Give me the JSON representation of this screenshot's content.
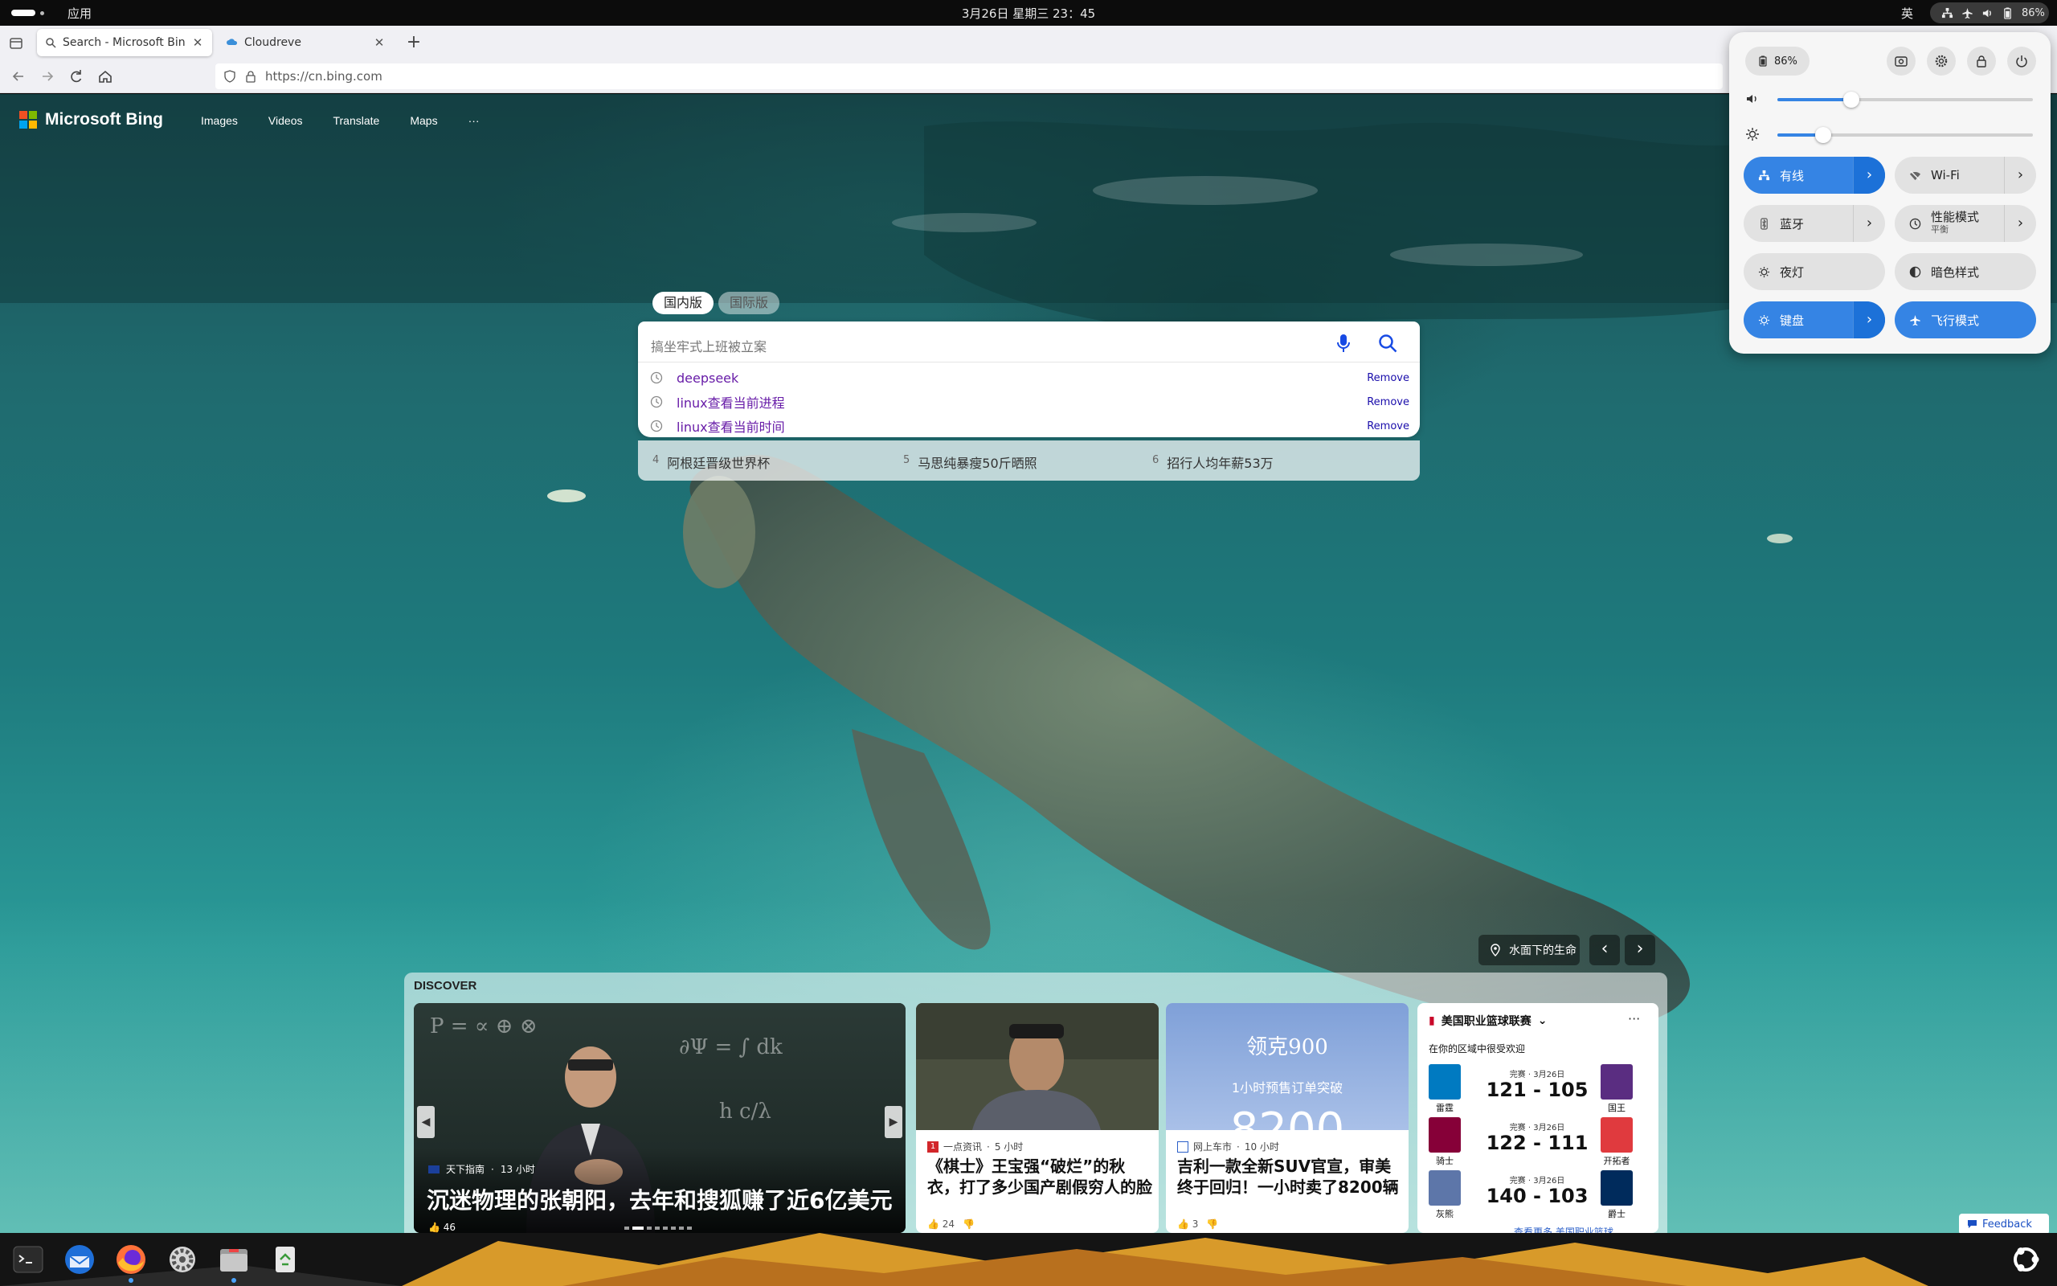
{
  "system_bar": {
    "apps_label": "应用",
    "clock": "3月26日 星期三 23：45",
    "input_method": "英",
    "battery_percent": "86%"
  },
  "browser": {
    "tabs": [
      {
        "title": "Search - Microsoft Bing",
        "active": true
      },
      {
        "title": "Cloudreve",
        "active": false
      }
    ],
    "url": "https://cn.bing.com"
  },
  "bing": {
    "logo_text": "Microsoft Bing",
    "nav": [
      "Images",
      "Videos",
      "Translate",
      "Maps",
      "···"
    ],
    "scope_active": "国内版",
    "scope_inactive": "国际版",
    "search_placeholder": "搞坐牢式上班被立案",
    "history": [
      {
        "text": "deepseek",
        "action": "Remove"
      },
      {
        "text": "linux查看当前进程",
        "action": "Remove"
      },
      {
        "text": "linux查看当前时间",
        "action": "Remove"
      }
    ],
    "trending": [
      {
        "rank": "4",
        "text": "阿根廷晋级世界杯"
      },
      {
        "rank": "5",
        "text": "马思纯暴瘦50斤晒照"
      },
      {
        "rank": "6",
        "text": "招行人均年薪53万"
      }
    ],
    "image_title": "水面下的生命",
    "image_prev": "‹",
    "image_next": "›",
    "feedback": "Feedback"
  },
  "discover": {
    "header": "DISCOVER",
    "cards": [
      {
        "source": "天下指南",
        "time": "13 小时",
        "title": "沉迷物理的张朝阳，去年和搜狐赚了近6亿美元",
        "likes": "46"
      },
      {
        "source": "一点资讯",
        "time": "5 小时",
        "title": "《棋士》王宝强“破烂”的秋衣，打了多少国产剧假穷人的脸",
        "likes": "24"
      },
      {
        "source": "网上车市",
        "time": "10 小时",
        "title": "吉利一款全新SUV官宣，审美终于回归！一小时卖了8200辆",
        "likes": "3",
        "photo_text_1": "领克900",
        "photo_text_2": "1小时预售订单突破",
        "photo_text_3": "8200"
      }
    ],
    "nba": {
      "title": "美国职业篮球联赛",
      "more": "···",
      "subtitle": "在你的区域中很受欢迎",
      "see_more": "查看更多 美国职业篮球",
      "games": [
        {
          "label": "完赛 · 3月26日",
          "score": "121 - 105",
          "home": "雷霆",
          "away": "国王",
          "home_color": "#007ac1",
          "away_color": "#5a2d81"
        },
        {
          "label": "完赛 · 3月26日",
          "score": "122 - 111",
          "home": "骑士",
          "away": "开拓者",
          "home_color": "#860038",
          "away_color": "#e03a3e"
        },
        {
          "label": "完赛 · 3月26日",
          "score": "140 - 103",
          "home": "灰熊",
          "away": "爵士",
          "home_color": "#5d76a9",
          "away_color": "#002b5c"
        }
      ]
    }
  },
  "quick_settings": {
    "battery": "86%",
    "volume_level": 0.29,
    "brightness_level": 0.18,
    "toggles": [
      {
        "label": "有线",
        "on": true,
        "has_arrow": true
      },
      {
        "label": "Wi-Fi",
        "on": false,
        "has_arrow": true
      },
      {
        "label": "蓝牙",
        "on": false,
        "has_arrow": true
      },
      {
        "label": "性能模式",
        "sub": "平衡",
        "on": false,
        "has_arrow": true
      },
      {
        "label": "夜灯",
        "on": false,
        "has_arrow": false
      },
      {
        "label": "暗色样式",
        "on": false,
        "has_arrow": false
      },
      {
        "label": "键盘",
        "on": true,
        "has_arrow": true
      },
      {
        "label": "飞行模式",
        "on": true,
        "has_arrow": false
      }
    ]
  },
  "colors": {
    "accent": "#3584e4",
    "accent_dark": "#1c71d8",
    "link_visited": "#681da8",
    "link": "#1a0dab"
  }
}
